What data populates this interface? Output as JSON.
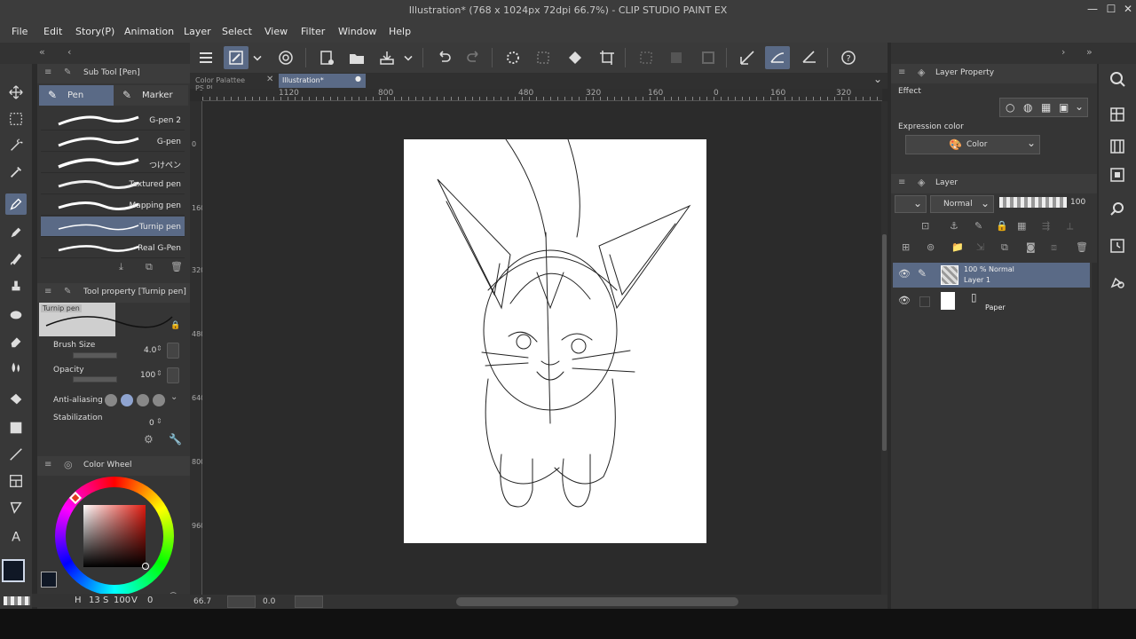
{
  "window": {
    "title": "Illustration* (768 x 1024px 72dpi 66.7%) - CLIP STUDIO PAINT EX"
  },
  "menu": [
    "File",
    "Edit",
    "Story(P)",
    "Animation",
    "Layer",
    "Select",
    "View",
    "Filter",
    "Window",
    "Help"
  ],
  "subtool": {
    "header": "Sub Tool [Pen]",
    "tabs": [
      "Pen",
      "Marker"
    ],
    "brushes": [
      "G-pen 2",
      "G-pen",
      "つけペン",
      "Textured pen",
      "Mapping pen",
      "Turnip pen",
      "Real G-Pen"
    ],
    "selected_brush": "Turnip pen"
  },
  "tool_property": {
    "header": "Tool property [Turnip pen]",
    "preview_label": "Turnip pen",
    "brush_size_label": "Brush Size",
    "brush_size_value": "4.0",
    "opacity_label": "Opacity",
    "opacity_value": "100",
    "anti_aliasing_label": "Anti-aliasing",
    "stabilization_label": "Stabilization",
    "stabilization_value": "0"
  },
  "color_wheel": {
    "header": "Color Wheel",
    "h_label": "H",
    "h_value": "13",
    "s_label": "S",
    "s_value": "100",
    "v_label": "V",
    "v_value": "0",
    "main_color": "#101826",
    "sub_color": "#2b2b2b"
  },
  "canvas": {
    "tabs": [
      "Color Palattee PS.Pl",
      "Illustration*"
    ],
    "ruler_h": [
      "1120",
      "800",
      "480",
      "320",
      "160",
      "0",
      "160",
      "320"
    ],
    "ruler_v": [
      "0",
      "160",
      "320",
      "480",
      "640",
      "800",
      "960"
    ],
    "zoom": "66.7",
    "angle": "0.0"
  },
  "layer_property": {
    "header": "Layer Property",
    "effect_label": "Effect",
    "expression_label": "Expression color",
    "expression_value": "Color"
  },
  "layer_panel": {
    "header": "Layer",
    "blend_mode": "Normal",
    "opacity": "100",
    "layers": [
      {
        "info": "100 % Normal",
        "name": "Layer 1"
      },
      {
        "info": "",
        "name": "Paper"
      }
    ]
  },
  "colors": {
    "accent": "#5a6a86",
    "panel": "#353535",
    "bg": "#2b2b2b"
  }
}
